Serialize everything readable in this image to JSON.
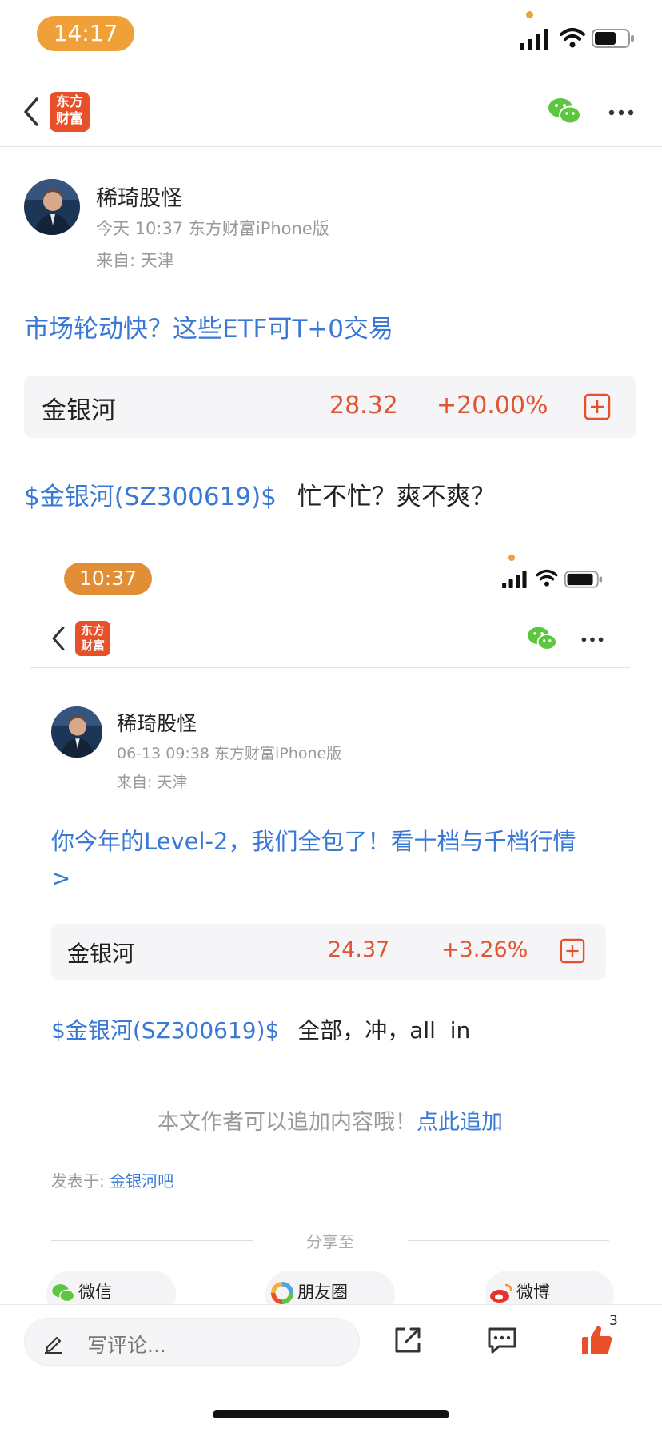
{
  "status_bar": {
    "time": "14:17"
  },
  "nav": {
    "logo_line1": "东方",
    "logo_line2": "财富"
  },
  "author": {
    "name": "稀琦股怪",
    "meta": "今天 10:37 东方财富iPhone版",
    "from": "来自: 天津"
  },
  "post": {
    "title": "市场轮动快？这些ETF可T+0交易",
    "stock": {
      "name": "金银河",
      "price": "28.32",
      "change": "+20.00%"
    },
    "body_tag": "$金银河(SZ300619)$",
    "body_text": "忙不忙？爽不爽？"
  },
  "embedded": {
    "time": "10:37",
    "logo_line1": "东方",
    "logo_line2": "财富",
    "author": {
      "name": "稀琦股怪",
      "meta": "06-13 09:38 东方财富iPhone版",
      "from": "来自: 天津"
    },
    "title": "你今年的Level-2，我们全包了！看十档与千档行情>",
    "stock": {
      "name": "金银河",
      "price": "24.37",
      "change": "+3.26%"
    },
    "body_tag": "$金银河(SZ300619)$",
    "body_text": "全部，冲，all  in",
    "append_text": "本文作者可以追加内容哦！",
    "append_link": "点此追加",
    "posted_label": "发表于: ",
    "posted_link": "金银河吧",
    "share_label": "分享至",
    "share": {
      "wechat": "微信",
      "moments": "朋友圈",
      "weibo": "微博"
    }
  },
  "bottom_bar": {
    "comment_placeholder": "写评论...",
    "like_count": "3"
  },
  "colors": {
    "accent_orange": "#F0A038",
    "link_blue": "#3A78D6",
    "price_red": "#E05533",
    "logo_red": "#E8502A"
  }
}
